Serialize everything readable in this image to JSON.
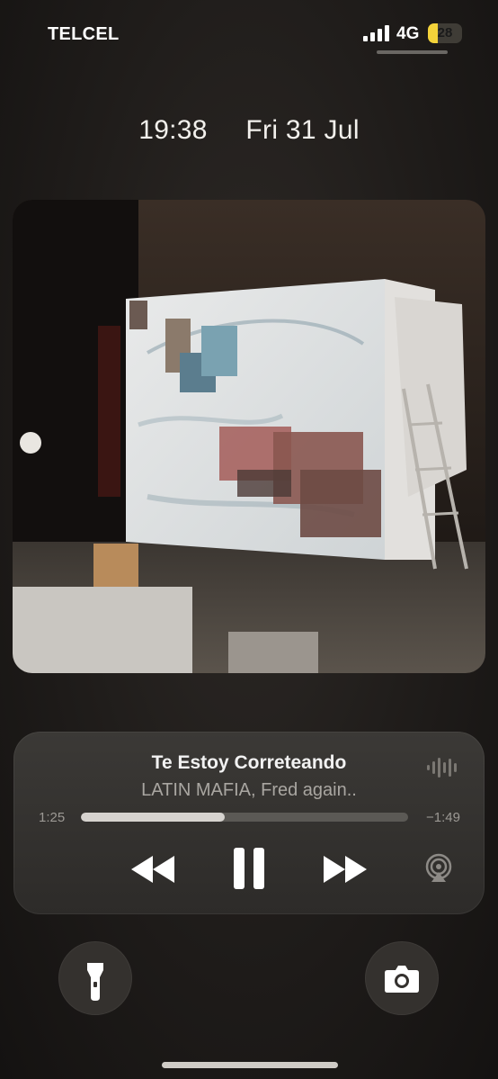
{
  "status_bar": {
    "carrier": "TELCEL",
    "network": "4G",
    "battery_level": "28",
    "battery_color": "#f4d33a",
    "signal_icon": "cellular-signal-icon"
  },
  "lock_screen": {
    "time": "19:38",
    "date": "Fri 31 Jul"
  },
  "artwork": {
    "icon": "album-artwork-image"
  },
  "now_playing": {
    "title": "Te Estoy Correteando",
    "artist": "LATIN MAFIA, Fred again..",
    "elapsed": "1:25",
    "remaining": "−1:49",
    "progress_fraction": 0.44,
    "controls": {
      "rewind_icon": "backward-icon",
      "pause_icon": "pause-icon",
      "forward_icon": "forward-icon",
      "airplay_icon": "airplay-audio-icon",
      "waveform_icon": "waveform-icon"
    }
  },
  "quick_actions": {
    "left_icon": "flashlight-icon",
    "right_icon": "camera-icon"
  }
}
